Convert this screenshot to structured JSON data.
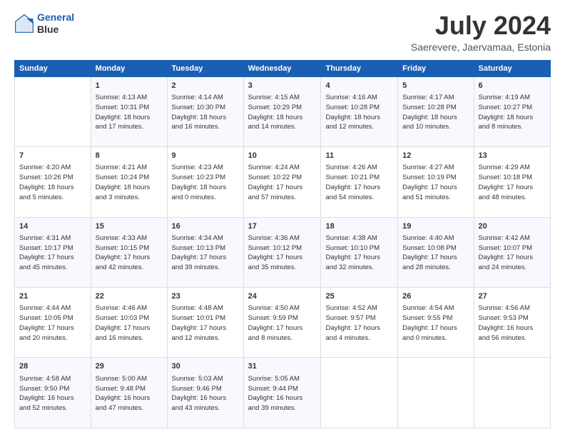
{
  "header": {
    "logo_line1": "General",
    "logo_line2": "Blue",
    "title": "July 2024",
    "subtitle": "Saerevere, Jaervamaa, Estonia"
  },
  "weekdays": [
    "Sunday",
    "Monday",
    "Tuesday",
    "Wednesday",
    "Thursday",
    "Friday",
    "Saturday"
  ],
  "weeks": [
    [
      {
        "day": "",
        "info": ""
      },
      {
        "day": "1",
        "info": "Sunrise: 4:13 AM\nSunset: 10:31 PM\nDaylight: 18 hours\nand 17 minutes."
      },
      {
        "day": "2",
        "info": "Sunrise: 4:14 AM\nSunset: 10:30 PM\nDaylight: 18 hours\nand 16 minutes."
      },
      {
        "day": "3",
        "info": "Sunrise: 4:15 AM\nSunset: 10:29 PM\nDaylight: 18 hours\nand 14 minutes."
      },
      {
        "day": "4",
        "info": "Sunrise: 4:16 AM\nSunset: 10:28 PM\nDaylight: 18 hours\nand 12 minutes."
      },
      {
        "day": "5",
        "info": "Sunrise: 4:17 AM\nSunset: 10:28 PM\nDaylight: 18 hours\nand 10 minutes."
      },
      {
        "day": "6",
        "info": "Sunrise: 4:19 AM\nSunset: 10:27 PM\nDaylight: 18 hours\nand 8 minutes."
      }
    ],
    [
      {
        "day": "7",
        "info": "Sunrise: 4:20 AM\nSunset: 10:26 PM\nDaylight: 18 hours\nand 5 minutes."
      },
      {
        "day": "8",
        "info": "Sunrise: 4:21 AM\nSunset: 10:24 PM\nDaylight: 18 hours\nand 3 minutes."
      },
      {
        "day": "9",
        "info": "Sunrise: 4:23 AM\nSunset: 10:23 PM\nDaylight: 18 hours\nand 0 minutes."
      },
      {
        "day": "10",
        "info": "Sunrise: 4:24 AM\nSunset: 10:22 PM\nDaylight: 17 hours\nand 57 minutes."
      },
      {
        "day": "11",
        "info": "Sunrise: 4:26 AM\nSunset: 10:21 PM\nDaylight: 17 hours\nand 54 minutes."
      },
      {
        "day": "12",
        "info": "Sunrise: 4:27 AM\nSunset: 10:19 PM\nDaylight: 17 hours\nand 51 minutes."
      },
      {
        "day": "13",
        "info": "Sunrise: 4:29 AM\nSunset: 10:18 PM\nDaylight: 17 hours\nand 48 minutes."
      }
    ],
    [
      {
        "day": "14",
        "info": "Sunrise: 4:31 AM\nSunset: 10:17 PM\nDaylight: 17 hours\nand 45 minutes."
      },
      {
        "day": "15",
        "info": "Sunrise: 4:33 AM\nSunset: 10:15 PM\nDaylight: 17 hours\nand 42 minutes."
      },
      {
        "day": "16",
        "info": "Sunrise: 4:34 AM\nSunset: 10:13 PM\nDaylight: 17 hours\nand 39 minutes."
      },
      {
        "day": "17",
        "info": "Sunrise: 4:36 AM\nSunset: 10:12 PM\nDaylight: 17 hours\nand 35 minutes."
      },
      {
        "day": "18",
        "info": "Sunrise: 4:38 AM\nSunset: 10:10 PM\nDaylight: 17 hours\nand 32 minutes."
      },
      {
        "day": "19",
        "info": "Sunrise: 4:40 AM\nSunset: 10:08 PM\nDaylight: 17 hours\nand 28 minutes."
      },
      {
        "day": "20",
        "info": "Sunrise: 4:42 AM\nSunset: 10:07 PM\nDaylight: 17 hours\nand 24 minutes."
      }
    ],
    [
      {
        "day": "21",
        "info": "Sunrise: 4:44 AM\nSunset: 10:05 PM\nDaylight: 17 hours\nand 20 minutes."
      },
      {
        "day": "22",
        "info": "Sunrise: 4:46 AM\nSunset: 10:03 PM\nDaylight: 17 hours\nand 16 minutes."
      },
      {
        "day": "23",
        "info": "Sunrise: 4:48 AM\nSunset: 10:01 PM\nDaylight: 17 hours\nand 12 minutes."
      },
      {
        "day": "24",
        "info": "Sunrise: 4:50 AM\nSunset: 9:59 PM\nDaylight: 17 hours\nand 8 minutes."
      },
      {
        "day": "25",
        "info": "Sunrise: 4:52 AM\nSunset: 9:57 PM\nDaylight: 17 hours\nand 4 minutes."
      },
      {
        "day": "26",
        "info": "Sunrise: 4:54 AM\nSunset: 9:55 PM\nDaylight: 17 hours\nand 0 minutes."
      },
      {
        "day": "27",
        "info": "Sunrise: 4:56 AM\nSunset: 9:53 PM\nDaylight: 16 hours\nand 56 minutes."
      }
    ],
    [
      {
        "day": "28",
        "info": "Sunrise: 4:58 AM\nSunset: 9:50 PM\nDaylight: 16 hours\nand 52 minutes."
      },
      {
        "day": "29",
        "info": "Sunrise: 5:00 AM\nSunset: 9:48 PM\nDaylight: 16 hours\nand 47 minutes."
      },
      {
        "day": "30",
        "info": "Sunrise: 5:03 AM\nSunset: 9:46 PM\nDaylight: 16 hours\nand 43 minutes."
      },
      {
        "day": "31",
        "info": "Sunrise: 5:05 AM\nSunset: 9:44 PM\nDaylight: 16 hours\nand 39 minutes."
      },
      {
        "day": "",
        "info": ""
      },
      {
        "day": "",
        "info": ""
      },
      {
        "day": "",
        "info": ""
      }
    ]
  ]
}
